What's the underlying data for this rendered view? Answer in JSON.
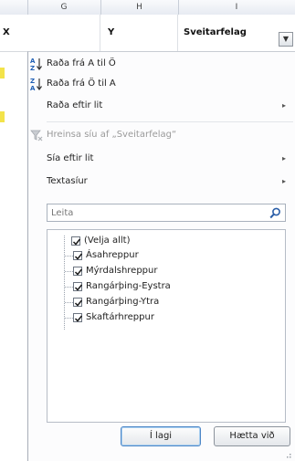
{
  "sheet": {
    "column_headers": [
      "G",
      "H",
      "I"
    ],
    "header_cells": {
      "col_x": "X",
      "col_y": "Y",
      "col_sveitarfelag": "Sveitarfelag"
    },
    "filter_button_glyph": "▼"
  },
  "menu": {
    "sort_asc": "Raða frá A til Ö",
    "sort_desc": "Raða frá Ö til A",
    "sort_color": "Raða eftir lit",
    "clear_filter": "Hreinsa síu af „Sveitarfelag“",
    "filter_color": "Sía eftir lit",
    "text_filters": "Textasíur",
    "submenu_arrow": "▸"
  },
  "search": {
    "placeholder": "Leita"
  },
  "checklist": [
    {
      "label": "(Velja allt)",
      "checked": true
    },
    {
      "label": "Ásahreppur",
      "checked": true
    },
    {
      "label": "Mýrdalshreppur",
      "checked": true
    },
    {
      "label": "Rangárþing-Eystra",
      "checked": true
    },
    {
      "label": "Rangárþing-Ytra",
      "checked": true
    },
    {
      "label": "Skaftárhreppur",
      "checked": true
    }
  ],
  "buttons": {
    "ok": "Í lagi",
    "cancel": "Hætta við"
  },
  "icons": {
    "sort_asc": "sort-a-z-icon",
    "sort_desc": "sort-z-a-icon",
    "clear_filter": "clear-filter-icon",
    "search": "search-icon",
    "resize": "resize-grip-icon"
  },
  "colors": {
    "accent": "#4e87c7",
    "highlight": "#f3e34a"
  }
}
